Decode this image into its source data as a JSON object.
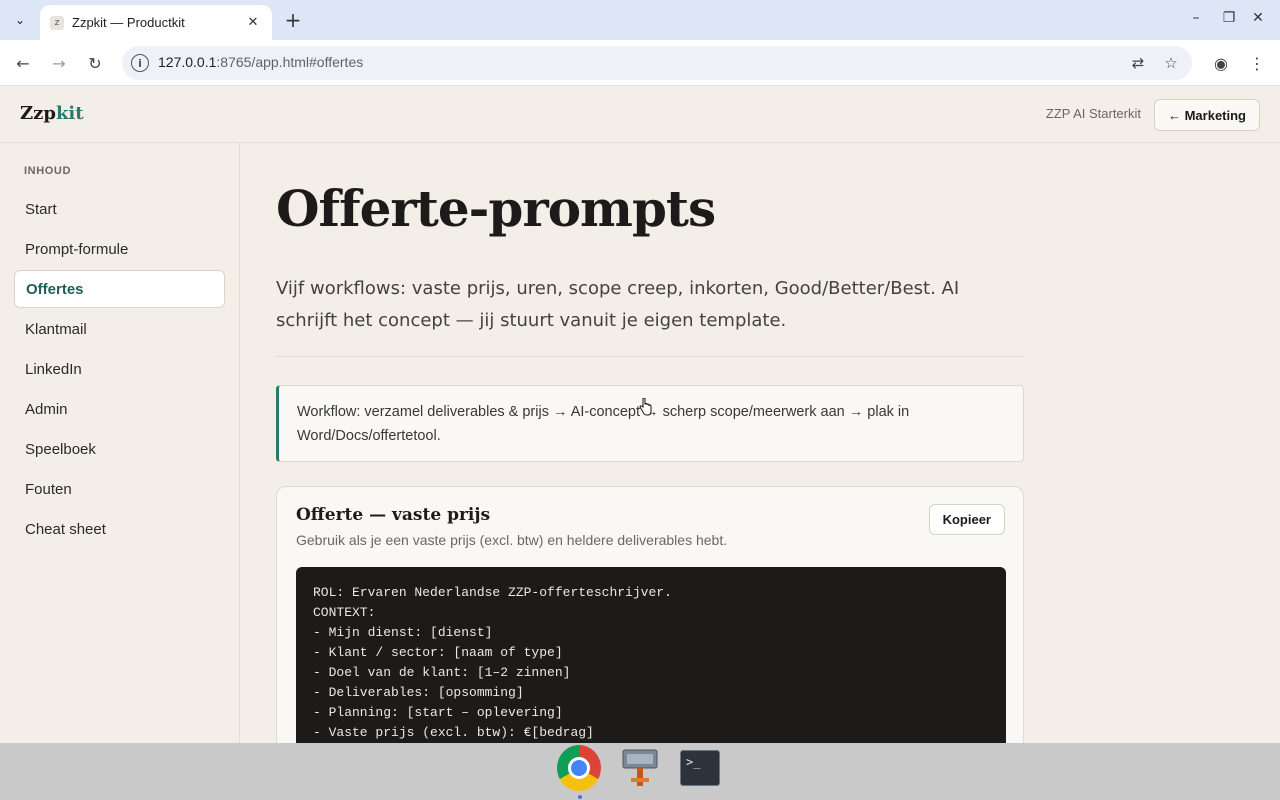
{
  "browser": {
    "tab_title": "Zzpkit — Productkit",
    "favicon_letter": "z",
    "url_host": "127.0.0.1",
    "url_rest": ":8765/app.html#offertes"
  },
  "header": {
    "logo_main": "Zzp",
    "logo_accent": "kit",
    "tagline": "ZZP AI Starterkit",
    "back_button": "← Marketing"
  },
  "sidebar": {
    "heading": "INHOUD",
    "items": [
      {
        "label": "Start"
      },
      {
        "label": "Prompt-formule"
      },
      {
        "label": "Offertes",
        "active": true
      },
      {
        "label": "Klantmail"
      },
      {
        "label": "LinkedIn"
      },
      {
        "label": "Admin"
      },
      {
        "label": "Speelboek"
      },
      {
        "label": "Fouten"
      },
      {
        "label": "Cheat sheet"
      }
    ]
  },
  "main": {
    "title": "Offerte-prompts",
    "lede": "Vijf workflows: vaste prijs, uren, scope creep, inkorten, Good/Better/Best. AI schrijft het concept — jij stuurt vanuit je eigen template.",
    "callout": "Workflow: verzamel deliverables & prijs → AI-concept → scherp scope/meerwerk aan → plak in Word/Docs/offertetool.",
    "card": {
      "title": "Offerte — vaste prijs",
      "subtitle": "Gebruik als je een vaste prijs (excl. btw) en heldere deliverables hebt.",
      "copy_button": "Kopieer",
      "code_lines": [
        "ROL: Ervaren Nederlandse ZZP-offerteschrijver.",
        "CONTEXT:",
        "- Mijn dienst: [dienst]",
        "- Klant / sector: [naam of type]",
        "- Doel van de klant: [1–2 zinnen]",
        "- Deliverables: [opsomming]",
        "- Planning: [start – oplevering]",
        "- Vaste prijs (excl. btw): €[bedrag]"
      ]
    }
  },
  "colors": {
    "accent": "#2b7a6f",
    "page_bg": "#f3efe8",
    "code_bg": "#1c1b19"
  }
}
